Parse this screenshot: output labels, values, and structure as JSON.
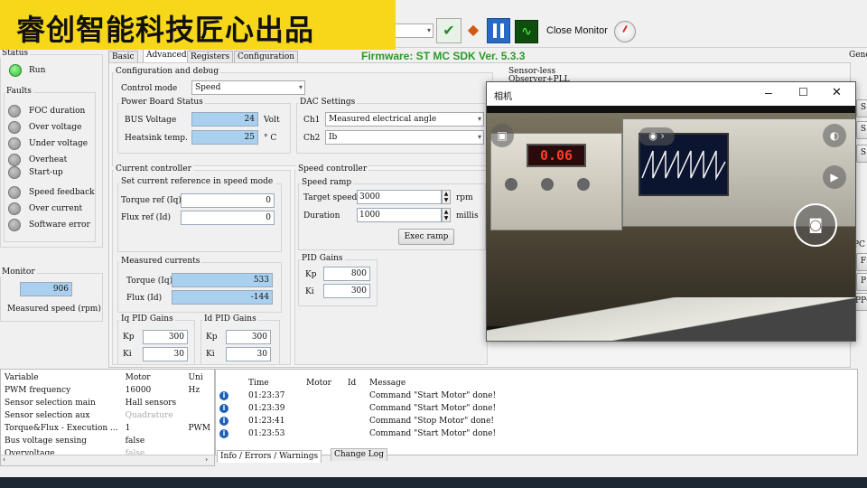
{
  "watermark": "睿创智能科技匠心出品",
  "toolbar": {
    "close_monitor": "Close Monitor"
  },
  "firmware": "Firmware: ST MC SDK Ver. 5.3.3",
  "status": {
    "title": "Status",
    "run": "Run",
    "faults_title": "Faults",
    "faults": [
      "FOC duration",
      "Over voltage",
      "Under voltage",
      "Overheat",
      "Start-up",
      "Speed feedback",
      "Over current",
      "Software error"
    ]
  },
  "monitor": {
    "title": "Monitor",
    "value": "906",
    "label": "Measured speed (rpm)"
  },
  "tabs": [
    "Basic",
    "Advanced",
    "Registers",
    "Configuration"
  ],
  "config": {
    "title": "Configuration and debug",
    "control_mode_label": "Control mode",
    "control_mode_value": "Speed",
    "power_board_title": "Power Board Status",
    "bus_voltage_label": "BUS Voltage",
    "bus_voltage_value": "24",
    "bus_voltage_unit": "Volt",
    "heatsink_label": "Heatsink temp.",
    "heatsink_value": "25",
    "heatsink_unit": "° C"
  },
  "dac": {
    "title": "DAC Settings",
    "ch1_label": "Ch1",
    "ch1_value": "Measured electrical angle",
    "ch2_label": "Ch2",
    "ch2_value": "Ib"
  },
  "sensorless": "Sensor-less Observer+PLL",
  "current_controller": {
    "title": "Current controller",
    "set_ref_title": "Set current reference in speed mode",
    "torque_ref_label": "Torque ref (Iq)",
    "torque_ref_value": "0",
    "flux_ref_label": "Flux ref (Id)",
    "flux_ref_value": "0",
    "measured_title": "Measured currents",
    "torque_label": "Torque (Iq)",
    "torque_value": "533",
    "flux_label": "Flux (Id)",
    "flux_value": "-144",
    "iq_pid_title": "Iq PID Gains",
    "iq_kp": "300",
    "iq_ki": "30",
    "id_pid_title": "Id PID Gains",
    "id_kp": "300",
    "id_ki": "30",
    "kp_label": "Kp",
    "ki_label": "Ki"
  },
  "speed_controller": {
    "title": "Speed controller",
    "ramp_title": "Speed ramp",
    "target_label": "Target speed",
    "target_value": "3000",
    "target_unit": "rpm",
    "duration_label": "Duration",
    "duration_value": "1000",
    "duration_unit": "millis",
    "exec_ramp": "Exec ramp",
    "pid_title": "PID Gains",
    "kp_label": "Kp",
    "kp_value": "800",
    "ki_label": "Ki",
    "ki_value": "300"
  },
  "camera": {
    "title": "相机",
    "meter_reading": "0.06"
  },
  "variables": {
    "headers": [
      "Variable",
      "Motor",
      "Uni"
    ],
    "rows": [
      [
        "PWM frequency",
        "16000",
        "Hz"
      ],
      [
        "Sensor selection main",
        "Hall sensors",
        ""
      ],
      [
        "Sensor selection aux",
        "Quadrature",
        ""
      ],
      [
        "Torque&Flux - Execution ...",
        "1",
        "PWM"
      ],
      [
        "Bus voltage sensing",
        "false",
        ""
      ],
      [
        "Overvoltage",
        "false",
        ""
      ]
    ]
  },
  "log": {
    "headers": [
      "Time",
      "Motor",
      "Id",
      "Message"
    ],
    "rows": [
      [
        "01:23:37",
        "",
        "",
        "Command \"Start Motor\" done!"
      ],
      [
        "01:23:39",
        "",
        "",
        "Command \"Start Motor\" done!"
      ],
      [
        "01:23:41",
        "",
        "",
        "Command \"Stop Motor\" done!"
      ],
      [
        "01:23:53",
        "",
        "",
        "Command \"Start Motor\" done!"
      ]
    ],
    "tabs": [
      "Info / Errors / Warnings",
      "Change Log"
    ]
  },
  "right_edge": {
    "gen": "Gene",
    "labels": [
      "S",
      "S",
      "S",
      "PC",
      "F",
      "P",
      "PPC"
    ]
  },
  "colors": {
    "accent_blue": "#a9d1ef",
    "watermark_bg": "#f7d71a",
    "led_green": "#24c12a"
  }
}
